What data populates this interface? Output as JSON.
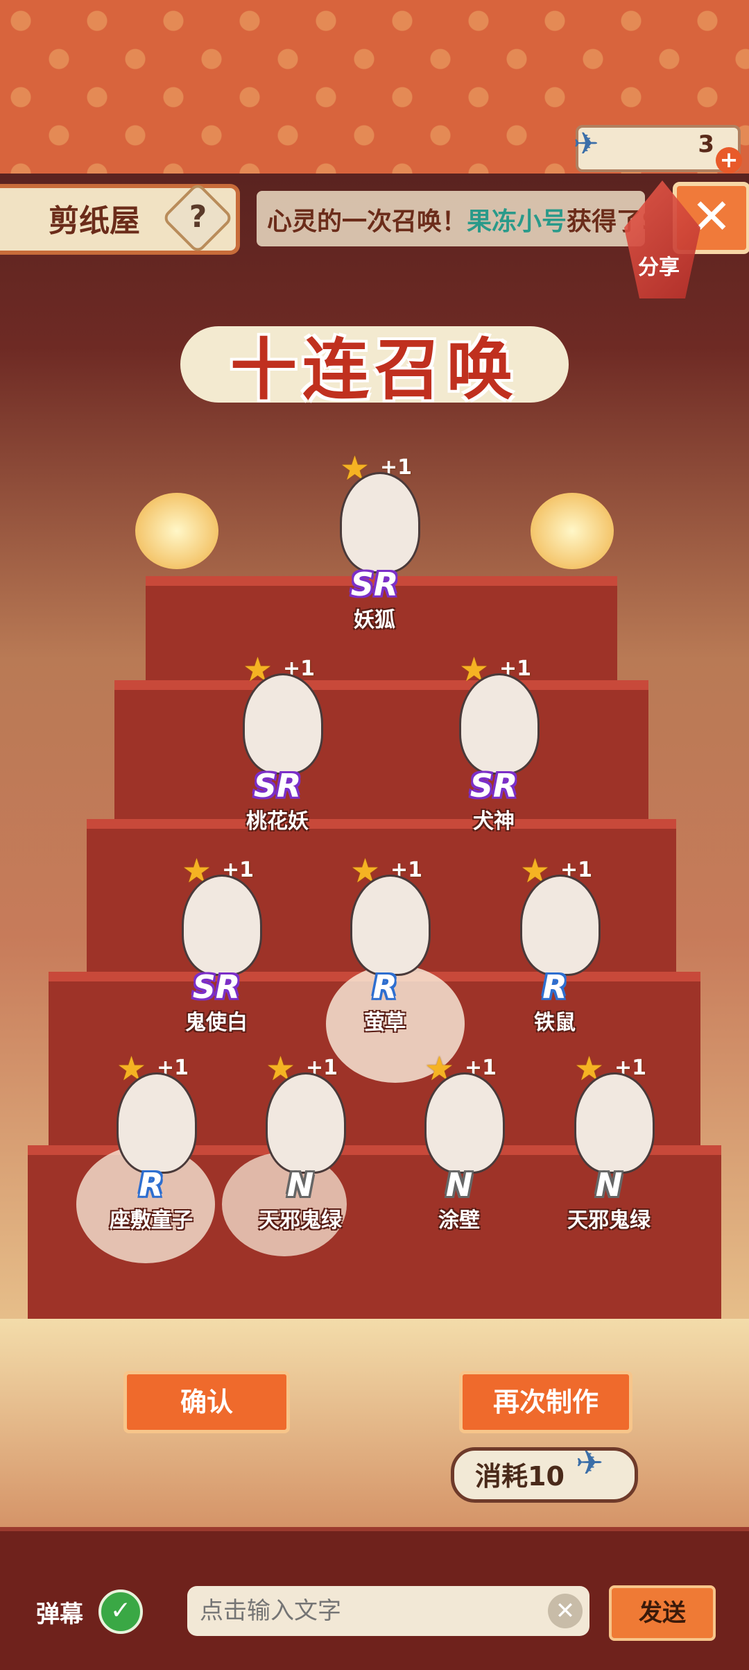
{
  "header": {
    "currency_value": "3",
    "currency_icon": "paper-crane-icon",
    "plus": "+"
  },
  "shop": {
    "name": "剪纸屋",
    "help": "?"
  },
  "ticker": {
    "text_prefix": "心灵的一次召唤！",
    "highlight": "果冻小号",
    "text_suffix": "获得了S"
  },
  "close": {
    "icon": "close-icon",
    "glyph": "✕"
  },
  "share": {
    "label": "分享"
  },
  "title": "十连召唤",
  "results": [
    {
      "name": "妖狐",
      "rarity": "SR",
      "bonus": "+1"
    },
    {
      "name": "桃花妖",
      "rarity": "SR",
      "bonus": "+1"
    },
    {
      "name": "犬神",
      "rarity": "SR",
      "bonus": "+1"
    },
    {
      "name": "鬼使白",
      "rarity": "SR",
      "bonus": "+1"
    },
    {
      "name": "萤草",
      "rarity": "R",
      "bonus": "+1"
    },
    {
      "name": "铁鼠",
      "rarity": "R",
      "bonus": "+1"
    },
    {
      "name": "座敷童子",
      "rarity": "R",
      "bonus": "+1"
    },
    {
      "name": "天邪鬼绿",
      "rarity": "N",
      "bonus": "+1"
    },
    {
      "name": "涂壁",
      "rarity": "N",
      "bonus": "+1"
    },
    {
      "name": "天邪鬼绿",
      "rarity": "N",
      "bonus": "+1"
    }
  ],
  "buttons": {
    "confirm": "确认",
    "again": "再次制作",
    "cost": "消耗10"
  },
  "bottom": {
    "danmu": "弹幕",
    "input_placeholder": "点击输入文字",
    "send": "发送"
  },
  "colors": {
    "accent": "#ef6a2c",
    "sr": "#7b2fc8",
    "r": "#2e6fd0",
    "n": "#666666"
  }
}
